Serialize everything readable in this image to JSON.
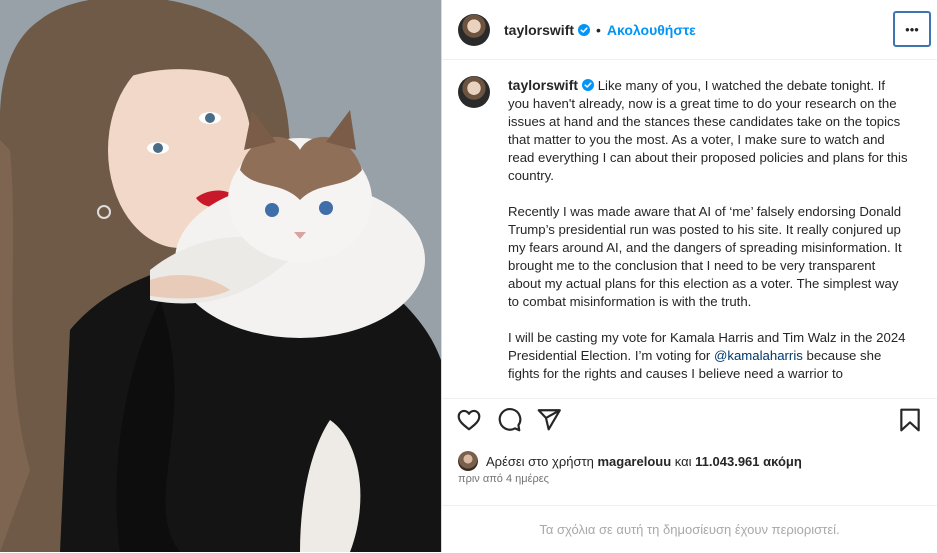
{
  "post": {
    "username": "taylorswift",
    "separator": "•",
    "follow_label": "Ακολουθήστε",
    "more_label": "•••",
    "photo_alt": "Portrait of a woman with long wavy hair holding a ragdoll cat",
    "caption": {
      "username": "taylorswift",
      "paragraph_1": "Like many of you, I watched the debate tonight. If you haven't already, now is a great time to do your research on the issues at hand and the stances these candidates take on the topics that matter to you the most. As a voter, I make sure to watch and read everything I can about their proposed policies and plans for this country.",
      "paragraph_2": "Recently I was made aware that AI of ‘me’ falsely endorsing Donald Trump’s presidential run was posted to his site. It really conjured up my fears around AI, and the dangers of spreading misinformation. It brought me to the conclusion that I need to be very transparent about my actual plans for this election as a voter. The simplest way to combat misinformation is with the truth.",
      "paragraph_3_start": "I will be casting my vote for Kamala Harris and Tim Walz in the 2024 Presidential Election. I’m voting for ",
      "paragraph_3_mention": "@kamalaharris",
      "paragraph_3_end": " because she fights for the rights and causes I believe need a warrior to"
    },
    "actions": {
      "like_icon": "heart-icon",
      "comment_icon": "comment-icon",
      "share_icon": "share-icon",
      "save_icon": "bookmark-icon"
    },
    "likes": {
      "prefix": "Αρέσει στο χρήστη",
      "user": "magarelouu",
      "conjunction": "και",
      "count": "11.043.961",
      "suffix": "ακόμη"
    },
    "timestamp": "πριν από 4 ημέρες",
    "comments_disabled": "Τα σχόλια σε αυτή τη δημοσίευση έχουν περιοριστεί."
  },
  "colors": {
    "accent": "#0095f6",
    "verified": "#0095f6",
    "mention": "#00376b",
    "muted": "#a8a8a8"
  }
}
